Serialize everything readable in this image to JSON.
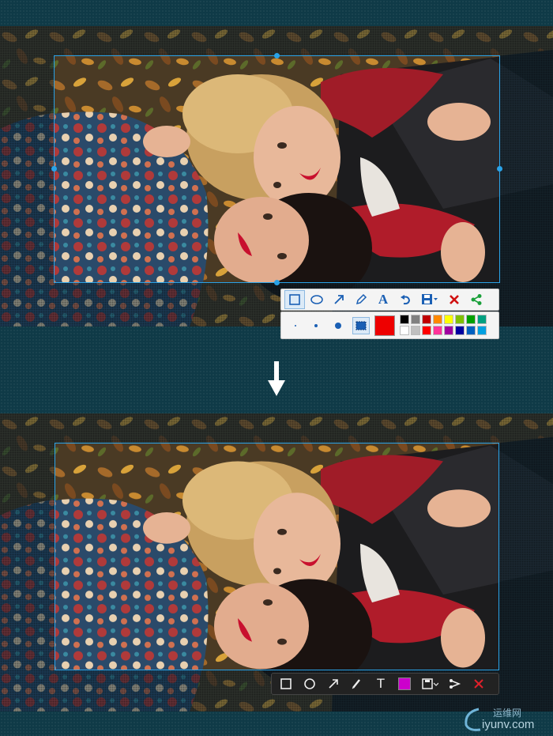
{
  "before": {
    "toolbar_top": {
      "tools": [
        {
          "name": "rectangle-icon",
          "active": true
        },
        {
          "name": "ellipse-icon",
          "active": false
        },
        {
          "name": "arrow-icon",
          "active": false
        },
        {
          "name": "pencil-icon",
          "active": false
        },
        {
          "name": "text-icon",
          "active": false
        },
        {
          "name": "undo-icon",
          "active": false
        },
        {
          "name": "save-icon",
          "active": false
        },
        {
          "name": "close-icon",
          "active": false
        },
        {
          "name": "share-icon",
          "active": false
        }
      ],
      "text_tool_label": "A"
    },
    "toolbar_bottom": {
      "brush_sizes": [
        "small",
        "medium",
        "large"
      ],
      "selected_color": "#ee0000",
      "palette_row1": [
        "#000000",
        "#808080",
        "#c00000",
        "#ff8800",
        "#ffff00",
        "#80c000",
        "#00a000",
        "#00a080"
      ],
      "palette_row2": [
        "#ffffff",
        "#c0c0c0",
        "#ff0000",
        "#ff3399",
        "#a000a0",
        "#0000a0",
        "#0060c0",
        "#00a0e0"
      ]
    }
  },
  "after": {
    "toolbar": {
      "tools": [
        {
          "name": "rectangle-icon"
        },
        {
          "name": "ellipse-icon"
        },
        {
          "name": "arrow-icon"
        },
        {
          "name": "pencil-icon"
        },
        {
          "name": "text-icon"
        },
        {
          "name": "color-swatch"
        },
        {
          "name": "save-icon"
        },
        {
          "name": "share-icon"
        },
        {
          "name": "close-icon"
        }
      ],
      "text_tool_label": "T",
      "swatch_color": "#cc00cc"
    }
  },
  "watermark": {
    "line1": "运维网",
    "line2": "iyunv.com"
  },
  "colors": {
    "selection_border": "#2aa3e8",
    "background": "#0f3a47"
  }
}
